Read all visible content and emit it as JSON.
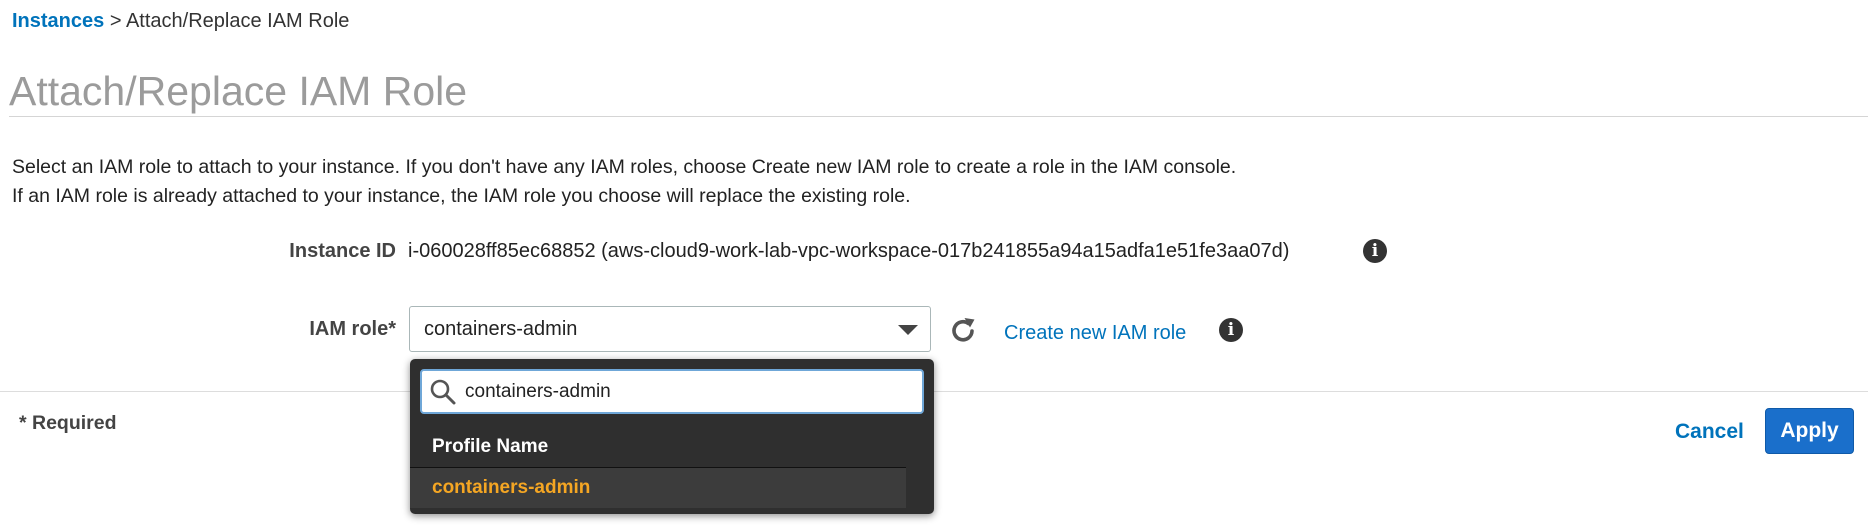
{
  "breadcrumb": {
    "link": "Instances",
    "separator": " > ",
    "current": "Attach/Replace IAM Role"
  },
  "page": {
    "title": "Attach/Replace IAM Role",
    "description_line1": "Select an IAM role to attach to your instance. If you don't have any IAM roles, choose Create new IAM role to create a role in the IAM console.",
    "description_line2": "If an IAM role is already attached to your instance, the IAM role you choose will replace the existing role."
  },
  "form": {
    "instance_id_label": "Instance ID",
    "instance_id_value": "i-060028ff85ec68852 (aws-cloud9-work-lab-vpc-workspace-017b241855a94a15adfa1e51fe3aa07d)",
    "iam_role_label": "IAM role*",
    "iam_role_value": "containers-admin",
    "create_link": "Create new IAM role",
    "info_glyph": "i"
  },
  "dropdown": {
    "search_value": "containers-admin",
    "column_header": "Profile Name",
    "options": [
      {
        "label": "containers-admin"
      }
    ]
  },
  "footer": {
    "required_note": "* Required",
    "cancel_label": "Cancel",
    "apply_label": "Apply"
  },
  "icons": {
    "info": "info-icon",
    "refresh": "refresh-icon",
    "search": "search-icon",
    "caret": "chevron-down-icon"
  },
  "colors": {
    "link": "#0073bb",
    "primary_button": "#1a6fcb",
    "dropdown_bg": "#2f2f2f",
    "selected_option_text": "#f5a623",
    "title_gray": "#9b9b9b"
  }
}
